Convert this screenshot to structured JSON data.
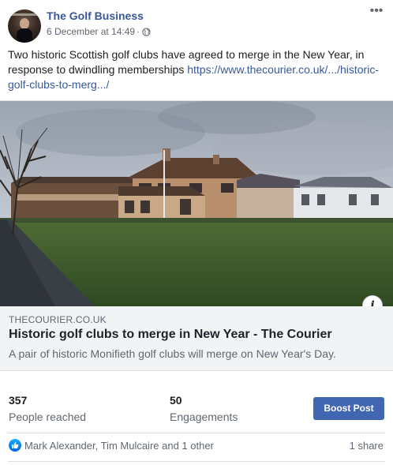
{
  "post": {
    "page_name": "The Golf Business",
    "timestamp": "6 December at 14:49",
    "separator": "·",
    "privacy_icon": "globe-icon",
    "more_icon": "more-dots-icon",
    "text": "Two historic Scottish golf clubs have agreed to merge in the New Year, in response to dwindling memberships ",
    "link_text": "https://www.thecourier.co.uk/.../historic-golf-clubs-to-merg.../"
  },
  "preview": {
    "domain": "THECOURIER.CO.UK",
    "title": "Historic golf clubs to merge in New Year - The Courier",
    "description": "A pair of historic Monifieth golf clubs will merge on New Year's Day.",
    "info_label": "i"
  },
  "insights": {
    "reached_value": "357",
    "reached_label": "People reached",
    "engagements_value": "50",
    "engagements_label": "Engagements",
    "boost_label": "Boost Post"
  },
  "reactions": {
    "icon": "like-icon",
    "names": "Mark Alexander, Tim Mulcaire and 1 other",
    "shares": "1 share"
  },
  "colors": {
    "link": "#385898",
    "button": "#4267b2",
    "muted": "#606770"
  }
}
